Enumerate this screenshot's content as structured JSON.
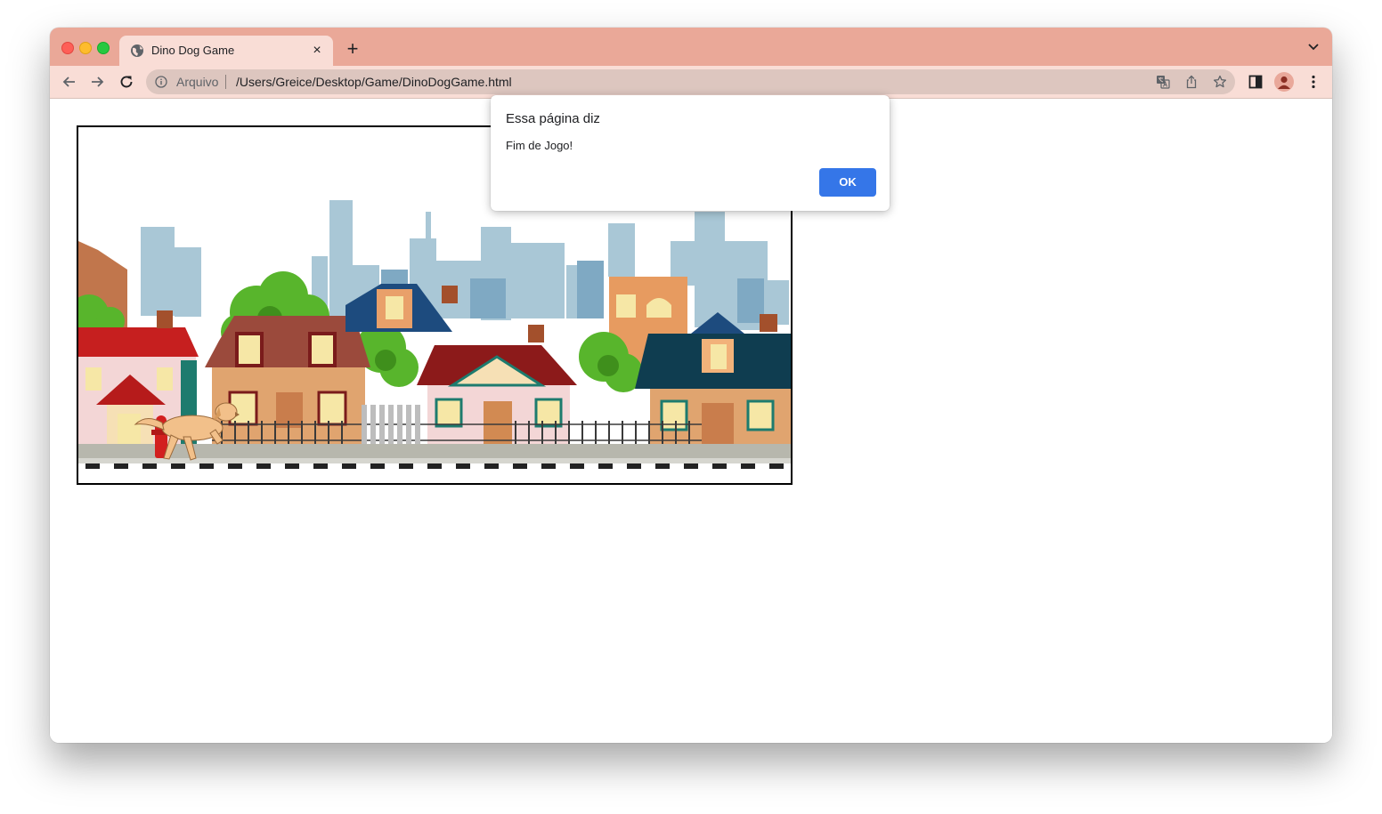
{
  "browser": {
    "tab_title": "Dino Dog Game",
    "tab_close_glyph": "×",
    "new_tab_glyph": "+",
    "address_scheme_label": "Arquivo",
    "address_url": "/Users/Greice/Desktop/Game/DinoDogGame.html",
    "tab_bar_color": "#eaa898",
    "toolbar_color": "#f9ddd6"
  },
  "game": {
    "scene": "city-street-background",
    "character": "dog"
  },
  "dialog": {
    "title": "Essa página diz",
    "message": "Fim de Jogo!",
    "ok_label": "OK",
    "ok_color": "#3576e8"
  }
}
